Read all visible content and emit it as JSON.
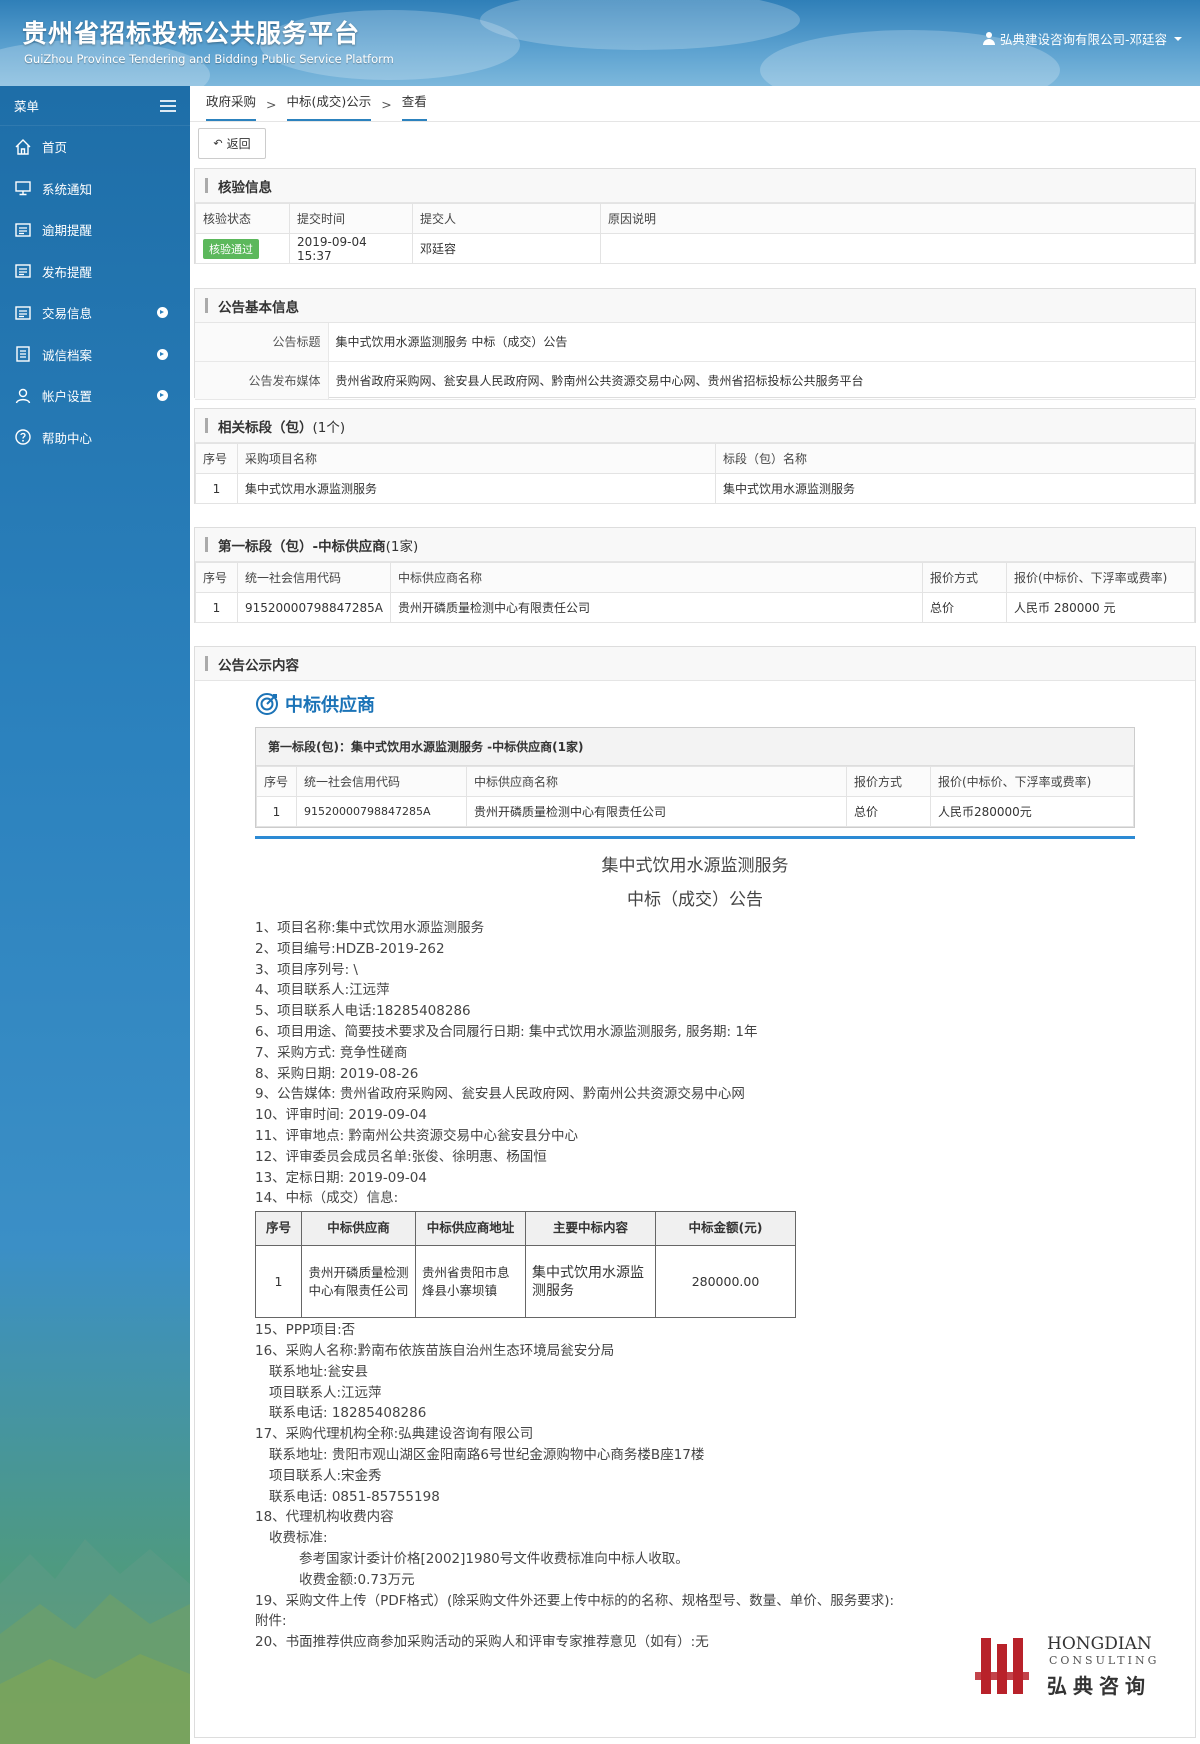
{
  "header": {
    "title_cn": "贵州省招标投标公共服务平台",
    "title_en": "GuiZhou Province Tendering and Bidding Public Service Platform",
    "user": "弘典建设咨询有限公司-邓廷容"
  },
  "sidebar": {
    "menu_label": "菜单",
    "items": [
      {
        "label": "首页",
        "icon": "home-icon"
      },
      {
        "label": "系统通知",
        "icon": "monitor-icon"
      },
      {
        "label": "逾期提醒",
        "icon": "list-icon"
      },
      {
        "label": "发布提醒",
        "icon": "list-icon"
      },
      {
        "label": "交易信息",
        "icon": "list-icon"
      },
      {
        "label": "诚信档案",
        "icon": "document-icon"
      },
      {
        "label": "帐户设置",
        "icon": "user-icon"
      },
      {
        "label": "帮助中心",
        "icon": "help-icon"
      }
    ]
  },
  "breadcrumb": [
    "政府采购",
    "中标(成交)公示",
    "查看"
  ],
  "back_button": "返回",
  "verify": {
    "title": "核验信息",
    "headers": [
      "核验状态",
      "提交时间",
      "提交人",
      "原因说明"
    ],
    "status": "核验通过",
    "time": "2019-09-04 15:37",
    "submitter": "邓廷容",
    "reason": ""
  },
  "basic": {
    "title": "公告基本信息",
    "label_title": "公告标题",
    "value_title": "集中式饮用水源监测服务 中标（成交）公告",
    "label_media": "公告发布媒体",
    "value_media": "贵州省政府采购网、瓮安县人民政府网、黔南州公共资源交易中心网、贵州省招标投标公共服务平台"
  },
  "sections": {
    "title": "相关标段（包）",
    "count": "(1个)",
    "headers": [
      "序号",
      "采购项目名称",
      "标段（包）名称"
    ],
    "row": [
      "1",
      "集中式饮用水源监测服务",
      "集中式饮用水源监测服务"
    ]
  },
  "suppliers": {
    "title": "第一标段（包）-中标供应商",
    "count": "(1家)",
    "headers": [
      "序号",
      "统一社会信用代码",
      "中标供应商名称",
      "报价方式",
      "报价(中标价、下浮率或费率)"
    ],
    "row": [
      "1",
      "91520000798847285A",
      "贵州开磷质量检测中心有限责任公司",
      "总价",
      "人民币 280000 元"
    ]
  },
  "content": {
    "title": "公告公示内容",
    "win_heading": "中标供应商",
    "sub": "第一标段(包)：集中式饮用水源监测服务 -中标供应商(1家)",
    "headers": [
      "序号",
      "统一社会信用代码",
      "中标供应商名称",
      "报价方式",
      "报价(中标价、下浮率或费率)"
    ],
    "row": [
      "1",
      "91520000798847285A",
      "贵州开磷质量检测中心有限责任公司",
      "总价",
      "人民币280000元"
    ],
    "doc_title1": "集中式饮用水源监测服务",
    "doc_title2": "中标（成交）公告",
    "lines_a": [
      "1、项目名称:集中式饮用水源监测服务",
      "2、项目编号:HDZB-2019-262",
      "3、项目序列号: \\",
      "4、项目联系人:江远萍",
      "5、项目联系人电话:18285408286",
      "6、项目用途、简要技术要求及合同履行日期: 集中式饮用水源监测服务, 服务期: 1年",
      "7、采购方式: 竞争性磋商",
      "8、采购日期: 2019-08-26",
      "9、公告媒体: 贵州省政府采购网、瓮安县人民政府网、黔南州公共资源交易中心网",
      "10、评审时间: 2019-09-04",
      "11、评审地点: 黔南州公共资源交易中心瓮安县分中心",
      "12、评审委员会成员名单:张俊、徐明惠、杨国恒",
      "13、定标日期: 2019-09-04",
      "14、中标（成交）信息:"
    ],
    "winner_headers": [
      "序号",
      "中标供应商",
      "中标供应商地址",
      "主要中标内容",
      "中标金额(元)"
    ],
    "winner_row": [
      "1",
      "贵州开磷质量检测中心有限责任公司",
      "贵州省贵阳市息烽县小寨坝镇",
      "集中式饮用水源监测服务",
      "280000.00"
    ],
    "lines_b": [
      {
        "text": "15、PPP项目:否",
        "indent": 0
      },
      {
        "text": "16、采购人名称:黔南布依族苗族自治州生态环境局瓮安分局",
        "indent": 0
      },
      {
        "text": "联系地址:瓮安县",
        "indent": 1
      },
      {
        "text": "项目联系人:江远萍",
        "indent": 1
      },
      {
        "text": "联系电话: 18285408286",
        "indent": 1
      },
      {
        "text": "17、采购代理机构全称:弘典建设咨询有限公司",
        "indent": 0
      },
      {
        "text": "联系地址: 贵阳市观山湖区金阳南路6号世纪金源购物中心商务楼B座17楼",
        "indent": 1
      },
      {
        "text": "项目联系人:宋金秀",
        "indent": 1
      },
      {
        "text": "联系电话: 0851-85755198",
        "indent": 1
      },
      {
        "text": "18、代理机构收费内容",
        "indent": 0
      },
      {
        "text": "收费标准:",
        "indent": 1
      },
      {
        "text": "参考国家计委计价格[2002]1980号文件收费标准向中标人收取。",
        "indent": 2
      },
      {
        "text": "收费金额:0.73万元",
        "indent": 2
      },
      {
        "text": "19、采购文件上传（PDF格式）(除采购文件外还要上传中标的的名称、规格型号、数量、单价、服务要求):",
        "indent": 0
      },
      {
        "text": "附件:",
        "indent": 0
      },
      {
        "text": "20、书面推荐供应商参加采购活动的采购人和评审专家推荐意见（如有）:无",
        "indent": 0
      }
    ]
  },
  "watermark": {
    "en1": "HONGDIAN",
    "en2": "CONSULTING",
    "cn": "弘典咨询"
  }
}
